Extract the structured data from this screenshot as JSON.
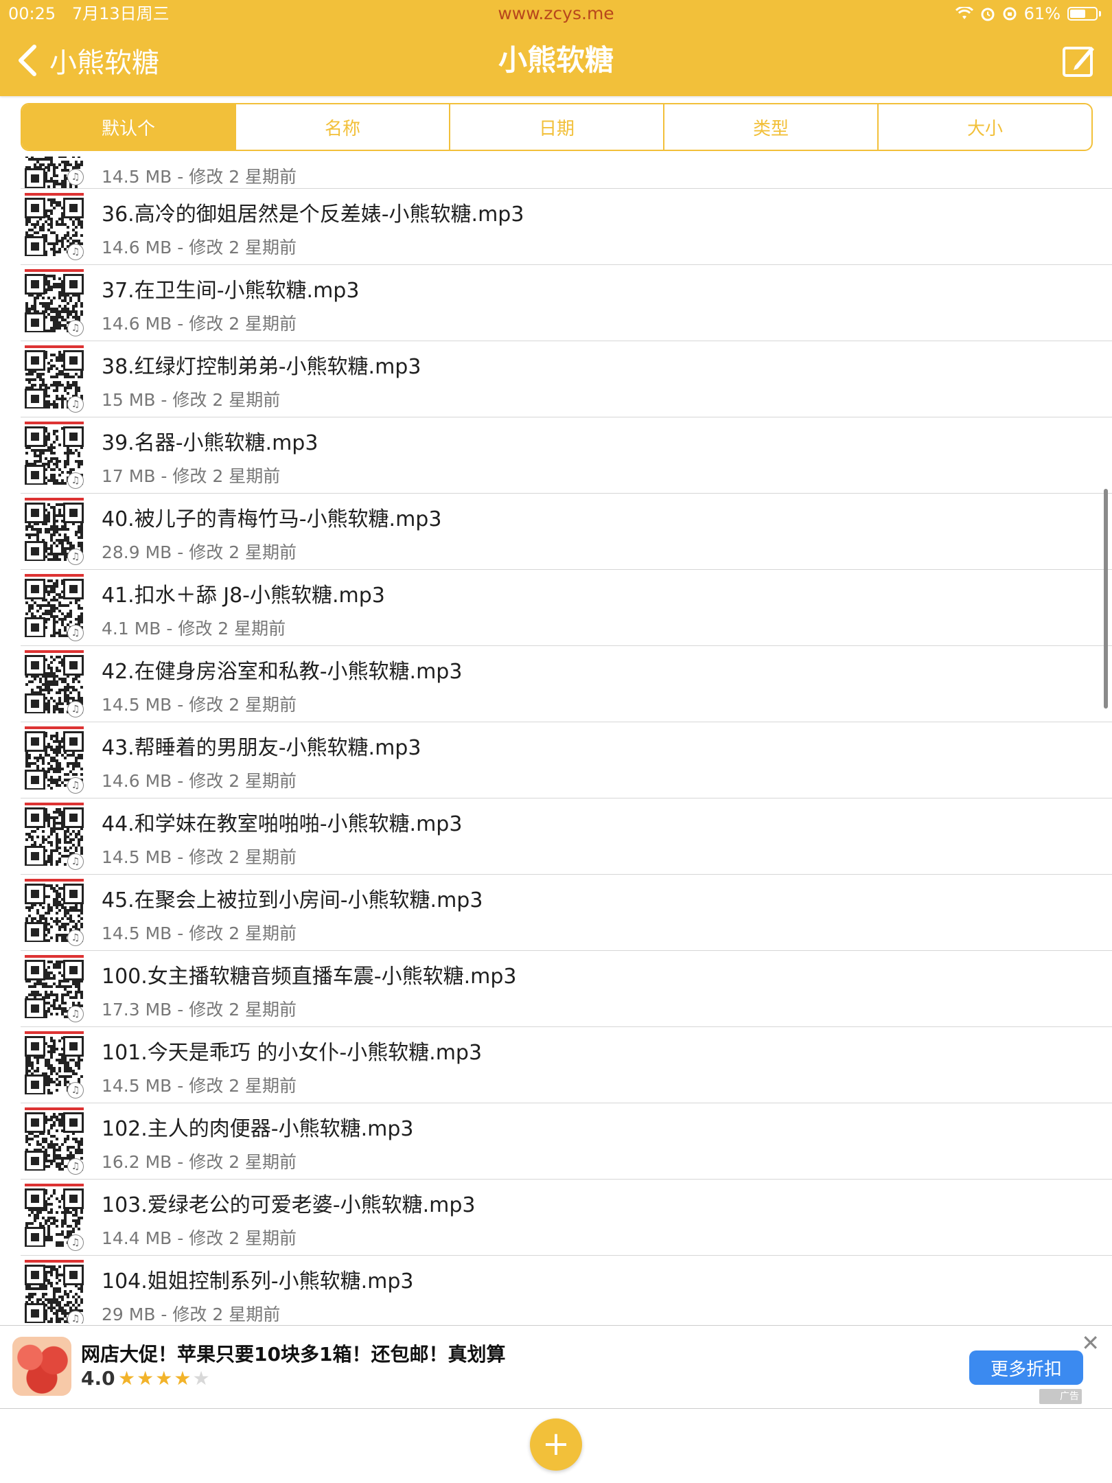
{
  "status_bar": {
    "time": "00:25",
    "date": "7月13日周三",
    "url": "www.zcys.me",
    "battery": "61%"
  },
  "header": {
    "back_label": "小熊软糖",
    "title": "小熊软糖",
    "accent_color": "#f2c03a"
  },
  "sort_tabs": [
    {
      "label": "默认个",
      "active": true
    },
    {
      "label": "名称",
      "active": false
    },
    {
      "label": "日期",
      "active": false
    },
    {
      "label": "类型",
      "active": false
    },
    {
      "label": "大小",
      "active": false
    }
  ],
  "files": [
    {
      "name": "",
      "meta": "14.5 MB - 修改 2 星期前"
    },
    {
      "name": "36.高冷的御姐居然是个反差婊-小熊软糖.mp3",
      "meta": "14.6 MB - 修改 2 星期前"
    },
    {
      "name": "37.在卫生间-小熊软糖.mp3",
      "meta": "14.6 MB - 修改 2 星期前"
    },
    {
      "name": "38.红绿灯控制弟弟-小熊软糖.mp3",
      "meta": "15 MB - 修改 2 星期前"
    },
    {
      "name": "39.名器-小熊软糖.mp3",
      "meta": "17 MB - 修改 2 星期前"
    },
    {
      "name": "40.被儿子的青梅竹马-小熊软糖.mp3",
      "meta": "28.9 MB - 修改 2 星期前"
    },
    {
      "name": "41.扣水＋舔 J8-小熊软糖.mp3",
      "meta": "4.1 MB - 修改 2 星期前"
    },
    {
      "name": "42.在健身房浴室和私教-小熊软糖.mp3",
      "meta": "14.5 MB - 修改 2 星期前"
    },
    {
      "name": "43.帮睡着的男朋友-小熊软糖.mp3",
      "meta": "14.6 MB - 修改 2 星期前"
    },
    {
      "name": "44.和学妹在教室啪啪啪-小熊软糖.mp3",
      "meta": "14.5 MB - 修改 2 星期前"
    },
    {
      "name": "45.在聚会上被拉到小房间-小熊软糖.mp3",
      "meta": "14.5 MB - 修改 2 星期前"
    },
    {
      "name": "100.女主播软糖音频直播车震-小熊软糖.mp3",
      "meta": "17.3 MB - 修改 2 星期前"
    },
    {
      "name": "101.今天是乖巧 的小女仆-小熊软糖.mp3",
      "meta": "14.5 MB - 修改 2 星期前"
    },
    {
      "name": "102.主人的肉便器-小熊软糖.mp3",
      "meta": "16.2 MB - 修改 2 星期前"
    },
    {
      "name": "103.爱绿老公的可爱老婆-小熊软糖.mp3",
      "meta": "14.4 MB - 修改 2 星期前"
    },
    {
      "name": "104.姐姐控制系列-小熊软糖.mp3",
      "meta": "29 MB - 修改 2 星期前"
    }
  ],
  "ad": {
    "title": "网店大促！苹果只要10块多1箱！还包邮！真划算",
    "rating": "4.0",
    "stars_filled": 4,
    "stars_total": 5,
    "cta_label": "更多折扣",
    "tag": "广告",
    "cta_color": "#3b8af0"
  },
  "fab": {
    "label": "+"
  }
}
